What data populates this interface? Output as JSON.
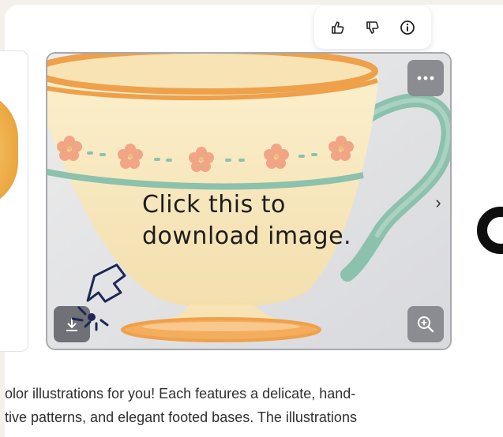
{
  "feedback": {
    "thumbs_up_icon": "thumbs-up-icon",
    "thumbs_down_icon": "thumbs-down-icon",
    "info_icon": "info-icon"
  },
  "image_card": {
    "more_icon": "ellipsis-icon",
    "zoom_icon": "zoom-in-icon",
    "download_icon": "download-icon",
    "next_icon": "chevron-right-icon",
    "next_label": "›"
  },
  "annotation": {
    "line1": "Click this to",
    "line2": "download image."
  },
  "description": {
    "line1": "olor illustrations for you! Each features a delicate, hand-",
    "line2": "tive patterns, and elegant footed bases. The illustrations"
  },
  "colors": {
    "cup_body": "#f8e8bd",
    "cup_rim": "#eea04b",
    "handle": "#8cc1ad",
    "flower": "#f2a585",
    "stripe": "#8cc1ad",
    "annotation_arrow": "#1e2755"
  }
}
